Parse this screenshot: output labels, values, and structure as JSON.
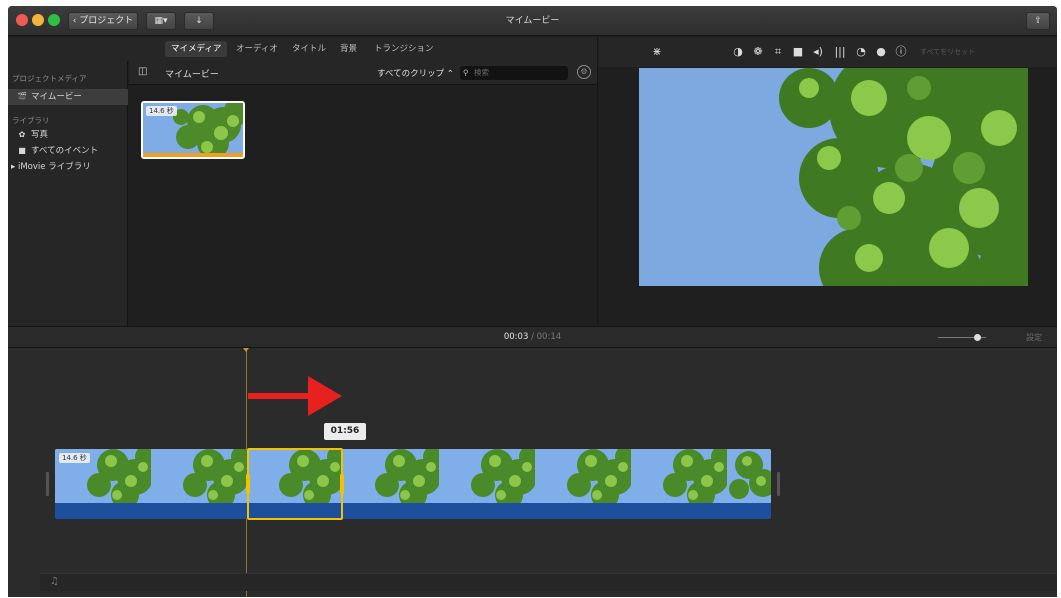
{
  "window": {
    "title": "マイムービー"
  },
  "toolbar": {
    "back_label": "プロジェクト"
  },
  "browser_tabs": [
    "マイメディア",
    "オーディオ",
    "タイトル",
    "背景",
    "トランジション"
  ],
  "sidebar": {
    "project_media_header": "プロジェクトメディア",
    "project_item": "マイムービー",
    "library_header": "ライブラリ",
    "library_items": [
      "写真",
      "すべてのイベント"
    ],
    "imovie_library": "iMovie ライブラリ"
  },
  "browser": {
    "title": "マイムービー",
    "filter_label": "すべてのクリップ",
    "search_placeholder": "検索",
    "clip_duration": "14.6 秒"
  },
  "viewer": {
    "reset_label": "すべてをリセット"
  },
  "playback": {
    "current_time": "00:03",
    "separator": "/",
    "total_time": "00:14"
  },
  "timeline": {
    "settings_label": "設定",
    "clip_duration": "14.6 秒",
    "tooltip_time": "01:56"
  },
  "colors": {
    "accent": "#f2c200",
    "arrow": "#e8201e",
    "audio_track": "#1d4f9c"
  },
  "icons": [
    "magic-wand-icon",
    "color-balance-icon",
    "color-palette-icon",
    "crop-icon",
    "stabilization-icon",
    "volume-icon",
    "equalizer-icon",
    "speed-icon",
    "filter-icon",
    "info-icon",
    "share-icon",
    "music-note-icon",
    "gear-icon",
    "search-icon"
  ]
}
